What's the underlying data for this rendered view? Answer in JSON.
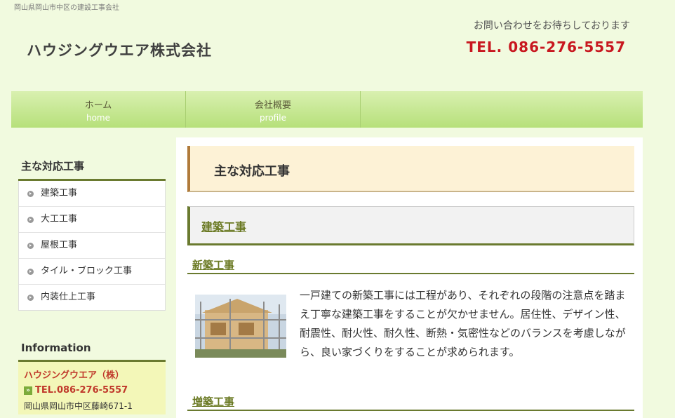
{
  "header": {
    "tagline": "岡山県岡山市中区の建設工事会社",
    "logo": "ハウジングウエア株式会社",
    "contact_message": "お問い合わせをお待ちしております",
    "tel": "TEL. 086-276-5557"
  },
  "nav": [
    {
      "ja": "ホーム",
      "en": "home"
    },
    {
      "ja": "会社概要",
      "en": "profile"
    }
  ],
  "sidebar": {
    "heading": "主な対応工事",
    "items": [
      "建築工事",
      "大工工事",
      "屋根工事",
      "タイル・ブロック工事",
      "内装仕上工事"
    ]
  },
  "info": {
    "heading": "Information",
    "company": "ハウジングウエア（株）",
    "tel": "TEL.086-276-5557",
    "address": "岡山県岡山市中区藤崎671-1"
  },
  "main": {
    "page_title": "主な対応工事",
    "section_title": "建築工事",
    "subsection1": "新築工事",
    "body1": "一戸建ての新築工事には工程があり、それぞれの段階の注意点を踏まえ丁寧な建築工事をすることが欠かせません。居住性、デザイン性、耐震性、耐火性、耐久性、断熱・気密性などのバランスを考慮しながら、良い家づくりをすることが求められます。",
    "subsection2": "増築工事"
  },
  "colors": {
    "background": "#f1fadf",
    "nav": "#b6e07a",
    "accent": "#6a7a2f",
    "tel_red": "#c8171f"
  },
  "icons": [
    "bullet-arrow-icon",
    "tel-arrow-icon"
  ]
}
